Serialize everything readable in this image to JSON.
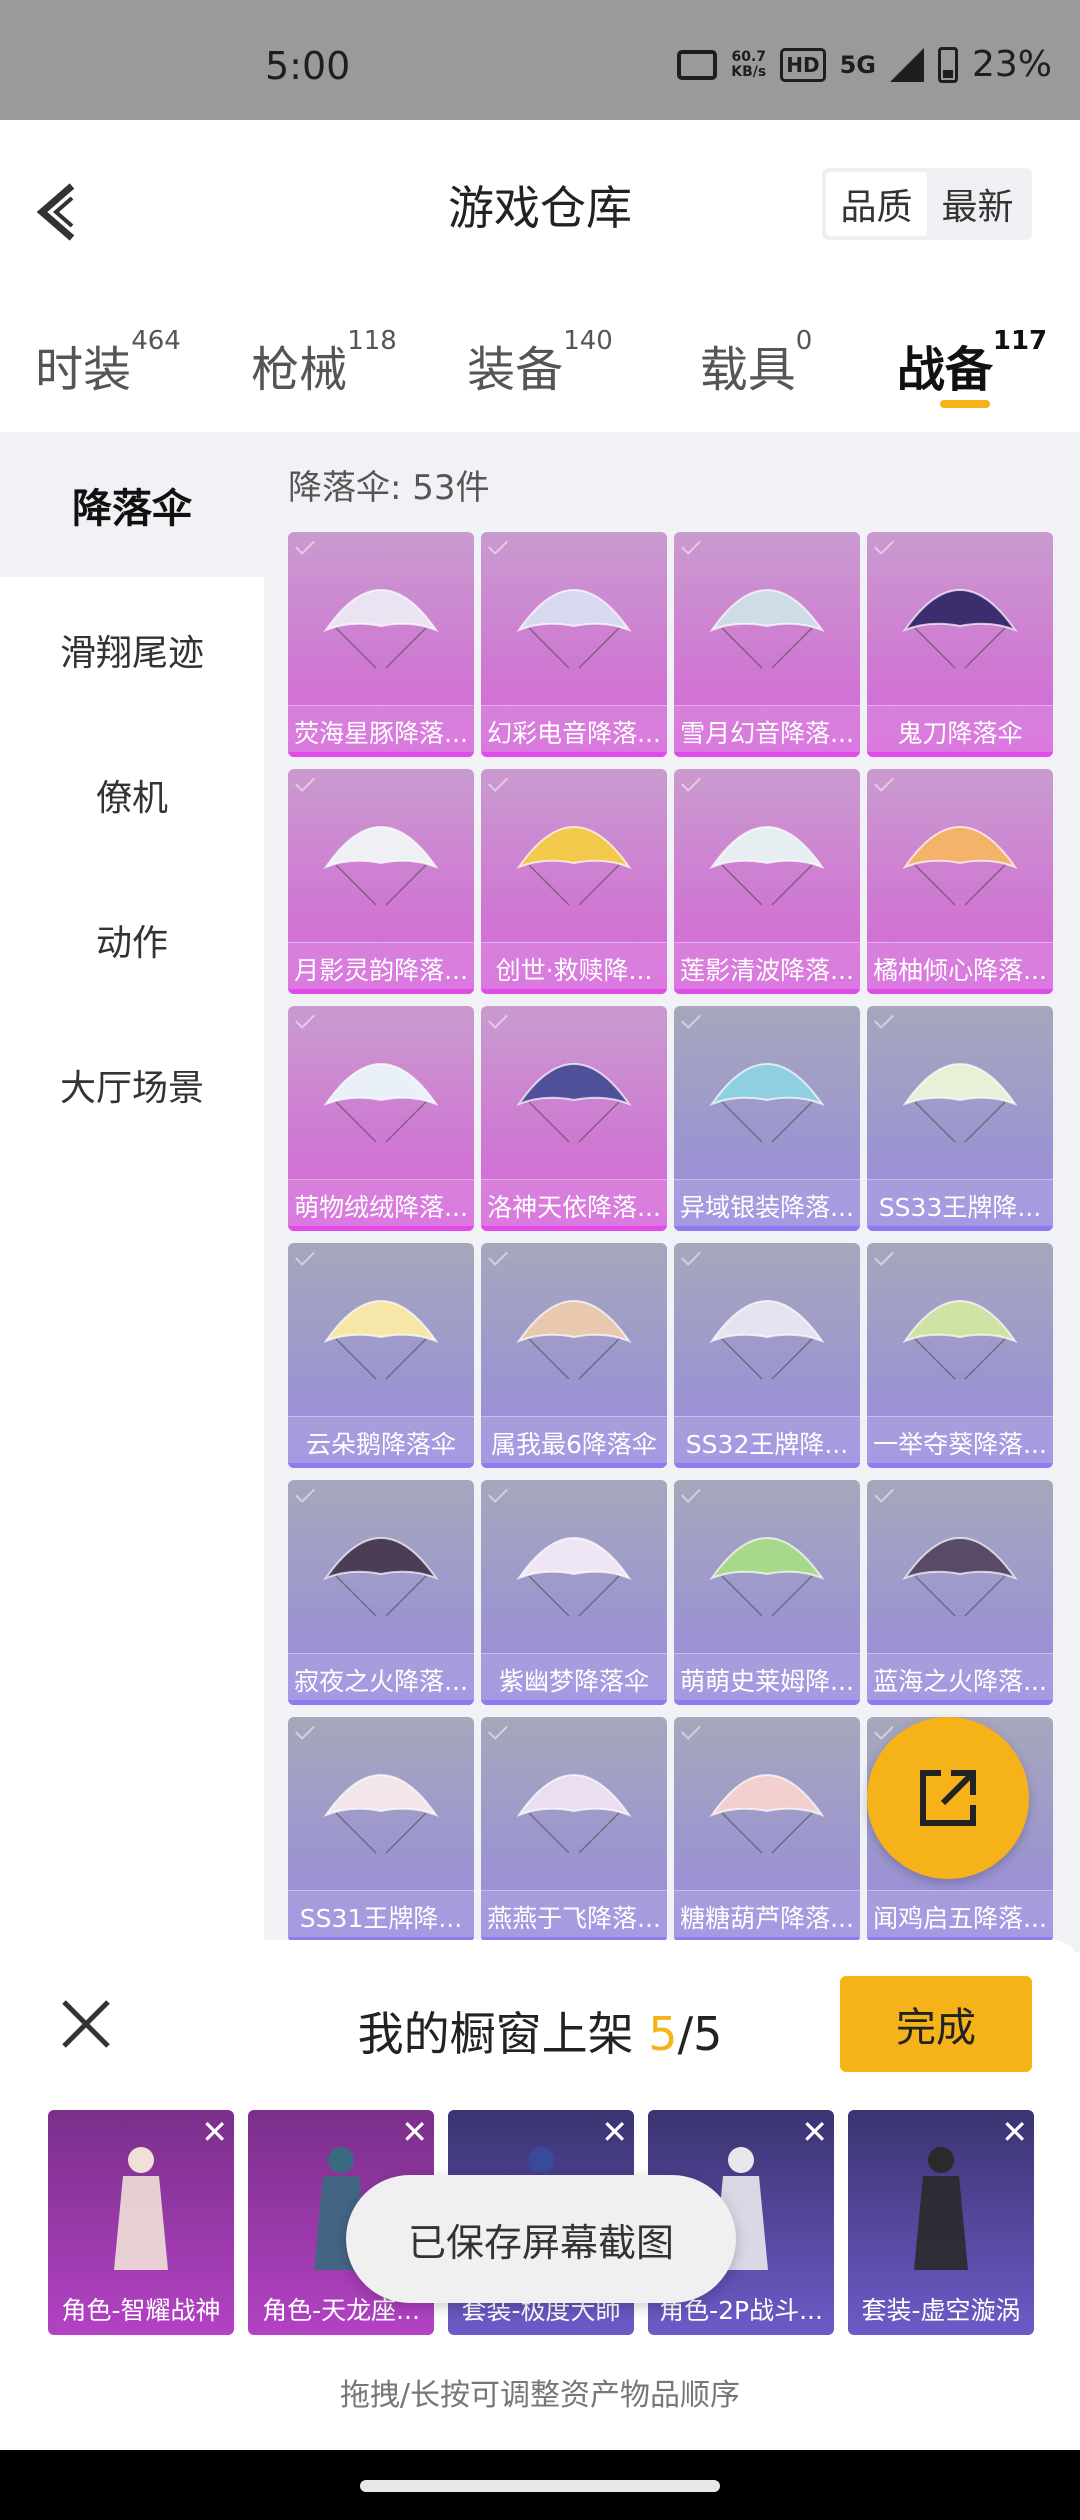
{
  "status_bar": {
    "time": "5:00",
    "net_speed_value": "60.7",
    "net_speed_unit": "KB/s",
    "hd": "HD",
    "network": "5G",
    "battery": "23%"
  },
  "header": {
    "title": "游戏仓库",
    "sort_options": [
      "品质",
      "最新"
    ],
    "active_sort": "品质"
  },
  "tabs": [
    {
      "label": "时装",
      "count": "464"
    },
    {
      "label": "枪械",
      "count": "118"
    },
    {
      "label": "装备",
      "count": "140"
    },
    {
      "label": "载具",
      "count": "0"
    },
    {
      "label": "战备",
      "count": "117",
      "active": true
    }
  ],
  "sidebar": {
    "items": [
      "降落伞",
      "滑翔尾迹",
      "僚机",
      "动作",
      "大厅场景"
    ],
    "active": "降落伞"
  },
  "content": {
    "count_label": "降落伞: 53件",
    "items": [
      {
        "name": "荧海星豚降落...",
        "rarity": "pink"
      },
      {
        "name": "幻彩电音降落...",
        "rarity": "pink"
      },
      {
        "name": "雪月幻音降落...",
        "rarity": "pink"
      },
      {
        "name": "鬼刀降落伞",
        "rarity": "pink"
      },
      {
        "name": "月影灵韵降落...",
        "rarity": "pink"
      },
      {
        "name": "创世·救赎降...",
        "rarity": "pink"
      },
      {
        "name": "莲影清波降落...",
        "rarity": "pink"
      },
      {
        "name": "橘柚倾心降落...",
        "rarity": "pink"
      },
      {
        "name": "萌物绒绒降落...",
        "rarity": "pink"
      },
      {
        "name": "洛神天依降落...",
        "rarity": "pink"
      },
      {
        "name": "异域银装降落...",
        "rarity": "purple"
      },
      {
        "name": "SS33王牌降...",
        "rarity": "purple"
      },
      {
        "name": "云朵鹅降落伞",
        "rarity": "purple"
      },
      {
        "name": "属我最6降落伞",
        "rarity": "purple"
      },
      {
        "name": "SS32王牌降...",
        "rarity": "purple"
      },
      {
        "name": "一举夺葵降落...",
        "rarity": "purple"
      },
      {
        "name": "寂夜之火降落...",
        "rarity": "purple"
      },
      {
        "name": "紫幽梦降落伞",
        "rarity": "purple"
      },
      {
        "name": "萌萌史莱姆降...",
        "rarity": "purple"
      },
      {
        "name": "蓝海之火降落...",
        "rarity": "purple"
      },
      {
        "name": "SS31王牌降...",
        "rarity": "purple"
      },
      {
        "name": "燕燕于飞降落...",
        "rarity": "purple"
      },
      {
        "name": "糖糖葫芦降落...",
        "rarity": "purple"
      },
      {
        "name": "闻鸡启五降落...",
        "rarity": "purple"
      }
    ]
  },
  "panel": {
    "title_prefix": "我的橱窗上架 ",
    "current": "5",
    "separator": "/",
    "total": "5",
    "done_label": "完成",
    "showcase": [
      {
        "name": "角色-智耀战神",
        "rarity": "pink"
      },
      {
        "name": "角色-天龙座...",
        "rarity": "pink"
      },
      {
        "name": "套装-极度大師",
        "rarity": "purple"
      },
      {
        "name": "角色-2P战斗...",
        "rarity": "purple"
      },
      {
        "name": "套装-虚空漩涡",
        "rarity": "purple"
      }
    ],
    "hint": "拖拽/长按可调整资产物品顺序"
  },
  "toast": "已保存屏幕截图",
  "colors": {
    "accent": "#f5b319",
    "legendary": "#d665dc",
    "epic": "#9b89e0"
  }
}
